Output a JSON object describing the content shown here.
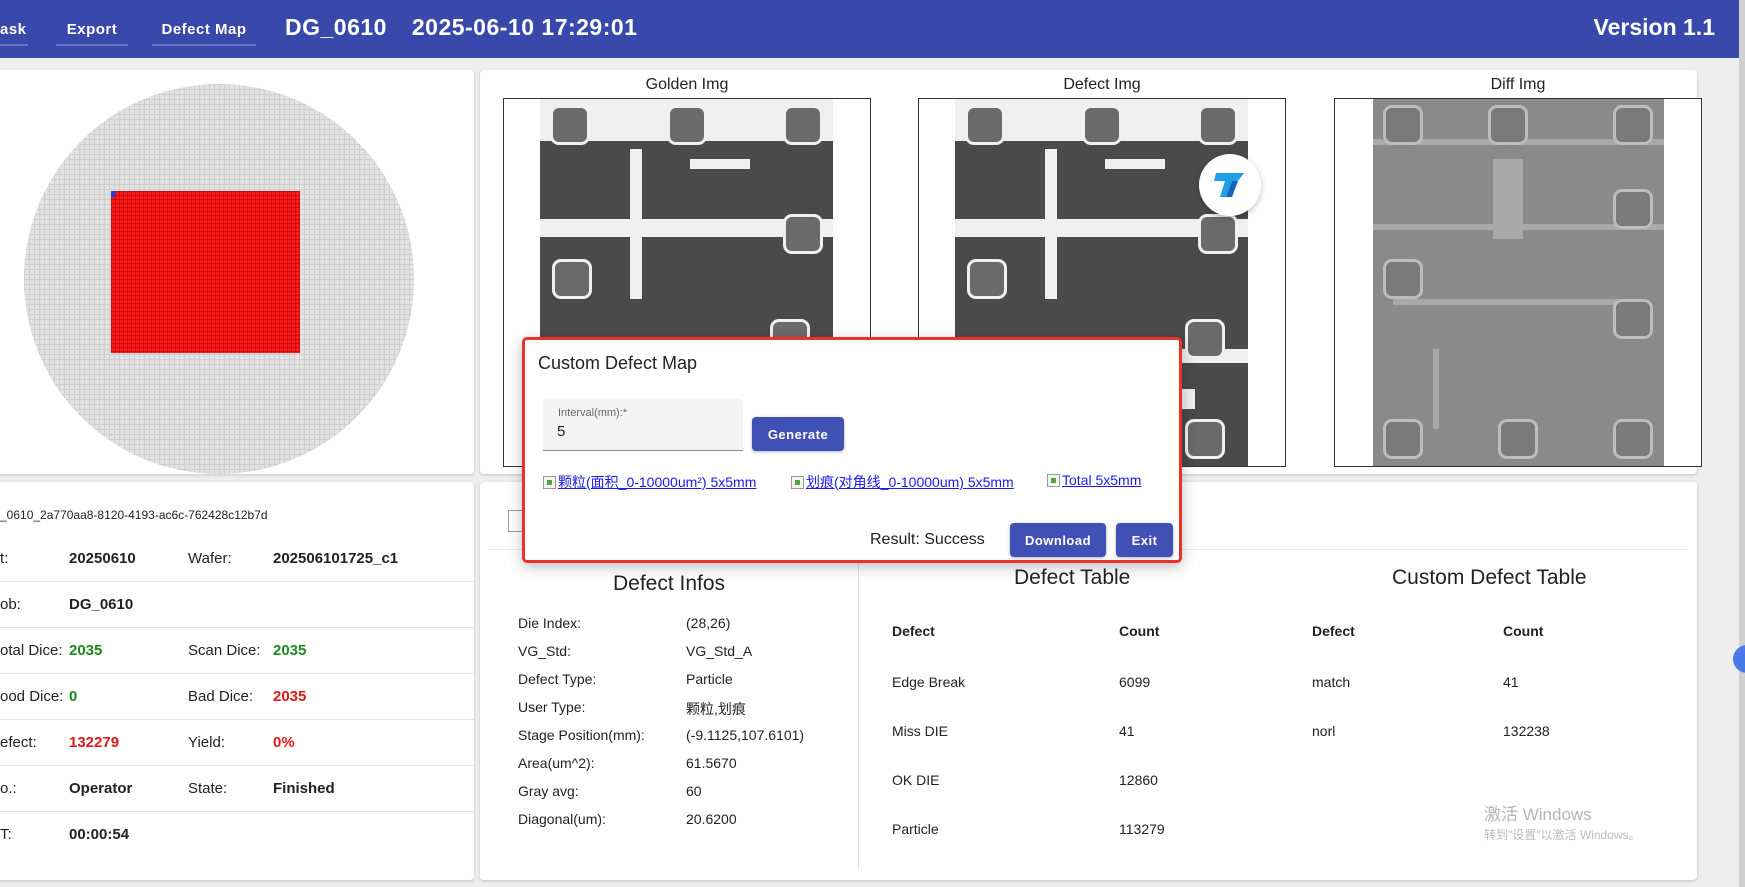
{
  "nav": {
    "task": "ask",
    "export": "Export",
    "defect_map": "Defect Map"
  },
  "header": {
    "job": "DG_0610",
    "timestamp": "2025-06-10 17:29:01",
    "version": "Version 1.1"
  },
  "wafer_map": {
    "wafer_color": "#e2e2e2",
    "defect_color": "#ff1a1a"
  },
  "info": {
    "task_id": "_0610_2a770aa8-8120-4193-ac6c-762428c12b7d",
    "lot_label": "t:",
    "lot_value": "20250610",
    "wafer_label": "Wafer:",
    "wafer_value": "202506101725_c1",
    "job_label": "ob:",
    "job_value": "DG_0610",
    "total_dice_label": "otal Dice:",
    "total_dice_value": "2035",
    "scan_dice_label": "Scan Dice:",
    "scan_dice_value": "2035",
    "good_dice_label": "ood Dice:",
    "good_dice_value": "0",
    "bad_dice_label": "Bad Dice:",
    "bad_dice_value": "2035",
    "defect_label": "efect:",
    "defect_value": "132279",
    "yield_label": "Yield:",
    "yield_value": "0%",
    "operator_label": "o.:",
    "operator_value": "Operator",
    "state_label": "State:",
    "state_value": "Finished",
    "time_label": "T:",
    "time_value": "00:00:54"
  },
  "images": {
    "golden": "Golden Img",
    "defect": "Defect Img",
    "diff": "Diff Img"
  },
  "defect_infos": {
    "title": "Defect Infos",
    "rows": [
      {
        "k": "Die Index:",
        "v": "(28,26)"
      },
      {
        "k": "VG_Std:",
        "v": "VG_Std_A"
      },
      {
        "k": "Defect Type:",
        "v": "Particle"
      },
      {
        "k": "User Type:",
        "v": "颗粒,划痕"
      },
      {
        "k": "Stage Position(mm):",
        "v": "(-9.1125,107.6101)"
      },
      {
        "k": "Area(um^2):",
        "v": "61.5670"
      },
      {
        "k": "Gray avg:",
        "v": "60"
      },
      {
        "k": "Diagonal(um):",
        "v": "20.6200"
      }
    ]
  },
  "defect_table": {
    "title": "Defect Table",
    "col_defect": "Defect",
    "col_count": "Count",
    "rows": [
      {
        "defect": "Edge Break",
        "count": "6099"
      },
      {
        "defect": "Miss DIE",
        "count": "41"
      },
      {
        "defect": "OK DIE",
        "count": "12860"
      },
      {
        "defect": "Particle",
        "count": "113279"
      }
    ]
  },
  "custom_table": {
    "title": "Custom Defect Table",
    "col_defect": "Defect",
    "col_count": "Count",
    "rows": [
      {
        "defect": "match",
        "count": "41"
      },
      {
        "defect": "norl",
        "count": "132238"
      }
    ]
  },
  "dialog": {
    "title": "Custom Defect Map",
    "interval_label": "Interval(mm):*",
    "interval_value": "5",
    "generate": "Generate",
    "link1": "颗粒(面积_0-10000um²) 5x5mm",
    "link2": "划痕(对角线_0-10000um) 5x5mm",
    "link3": "Total 5x5mm",
    "result": "Result: Success",
    "download": "Download",
    "exit": "Exit",
    "border_color": "#e8332a",
    "button_color": "#3f51b5"
  },
  "watermark": {
    "line1": "激活 Windows",
    "line2": "转到\"设置\"以激活 Windows。"
  },
  "colors": {
    "topbar": "#3949ab",
    "good": "#1a8a1a",
    "bad": "#e01818"
  }
}
